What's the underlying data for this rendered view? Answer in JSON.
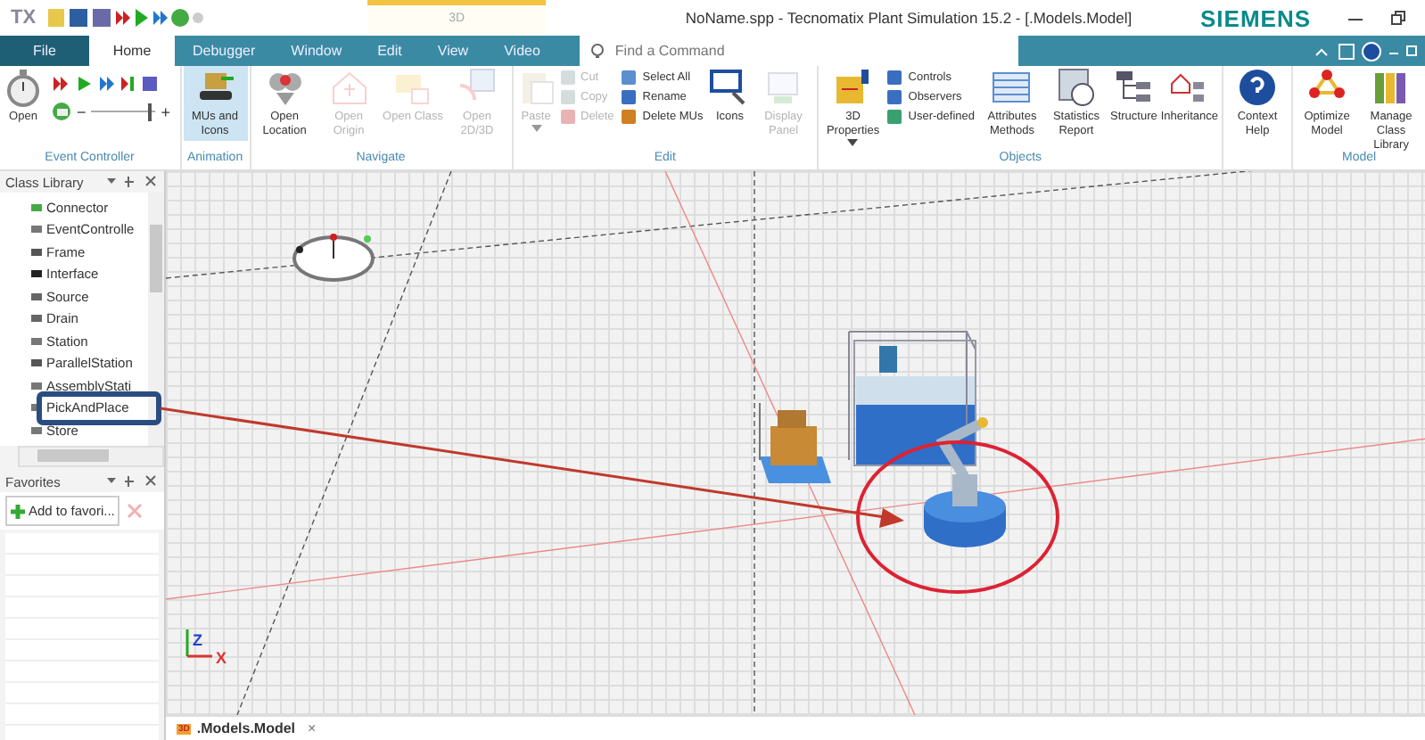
{
  "title_bar": {
    "logo": "TX",
    "contextual_tab": "3D",
    "title": "NoName.spp - Tecnomatix Plant Simulation 15.2 - [.Models.Model]",
    "brand": "SIEMENS"
  },
  "tabs": [
    {
      "label": "File",
      "kind": "file",
      "selected": false
    },
    {
      "label": "Home",
      "kind": "tab",
      "selected": true
    },
    {
      "label": "Debugger",
      "kind": "tab",
      "selected": false
    },
    {
      "label": "Window",
      "kind": "tab",
      "selected": false
    },
    {
      "label": "Edit",
      "kind": "tab",
      "selected": false
    },
    {
      "label": "View",
      "kind": "tab",
      "selected": false
    },
    {
      "label": "Video",
      "kind": "tab",
      "selected": false
    }
  ],
  "search": {
    "placeholder": "Find a Command"
  },
  "ribbon": {
    "groups": [
      {
        "label": "Event Controller",
        "items": [
          {
            "kind": "large",
            "label": "Open",
            "disabled": false
          },
          {
            "kind": "player",
            "minus": "−",
            "plus": "+",
            "level": 0.95
          }
        ]
      },
      {
        "label": "Animation",
        "items": [
          {
            "kind": "toggle",
            "label": "MUs and Icons",
            "disabled": false,
            "on": true
          }
        ]
      },
      {
        "label": "Navigate",
        "items": [
          {
            "kind": "large",
            "label": "Open Location",
            "disabled": false
          },
          {
            "kind": "large",
            "label": "Open Origin",
            "disabled": true
          },
          {
            "kind": "large",
            "label": "Open Class",
            "disabled": true
          },
          {
            "kind": "large",
            "label": "Open 2D/3D",
            "disabled": true
          }
        ]
      },
      {
        "label": "Edit",
        "items": [
          {
            "kind": "dropdown",
            "label": "Paste",
            "disabled": true
          },
          {
            "kind": "stack",
            "entries": [
              {
                "label": "Cut",
                "disabled": true
              },
              {
                "label": "Copy",
                "disabled": true
              },
              {
                "label": "Delete",
                "disabled": true
              }
            ]
          },
          {
            "kind": "stack",
            "entries": [
              {
                "label": "Select All",
                "disabled": false
              },
              {
                "label": "Rename",
                "disabled": false
              },
              {
                "label": "Delete MUs",
                "disabled": false
              }
            ]
          },
          {
            "kind": "large",
            "label": "Icons",
            "disabled": false
          },
          {
            "kind": "large",
            "label": "Display Panel",
            "disabled": true
          }
        ]
      },
      {
        "label": "Objects",
        "items": [
          {
            "kind": "menu",
            "label": "3D Properties",
            "disabled": false
          },
          {
            "kind": "stack",
            "entries": [
              {
                "label": "Controls",
                "disabled": false
              },
              {
                "label": "Observers",
                "disabled": false
              },
              {
                "label": "User-defined",
                "disabled": false
              }
            ]
          },
          {
            "kind": "large",
            "label": "Attributes Methods",
            "disabled": false
          },
          {
            "kind": "large",
            "label": "Statistics Report",
            "disabled": false
          },
          {
            "kind": "large",
            "label": "Structure",
            "disabled": false
          },
          {
            "kind": "large",
            "label": "Inheritance",
            "disabled": false
          }
        ]
      },
      {
        "items": [
          {
            "kind": "large",
            "label": "Context Help",
            "disabled": false
          }
        ]
      },
      {
        "label": "Model",
        "items": [
          {
            "kind": "large",
            "label": "Optimize Model",
            "disabled": false
          },
          {
            "kind": "large",
            "label": "Manage Class Library",
            "disabled": false
          }
        ]
      }
    ]
  },
  "class_library": {
    "title": "Class Library",
    "items": [
      "Connector",
      "EventControlle",
      "Frame",
      "Interface",
      "Source",
      "Drain",
      "Station",
      "ParallelStation",
      "AssemblyStati",
      "PickAndPlace",
      "Store"
    ]
  },
  "favorites": {
    "title": "Favorites",
    "add_button": "Add to favori..."
  },
  "viewport": {
    "axis_z": "Z",
    "axis_x": "X"
  },
  "document_tab": {
    "badge": "3D",
    "label": ".Models.Model",
    "close": "×"
  }
}
